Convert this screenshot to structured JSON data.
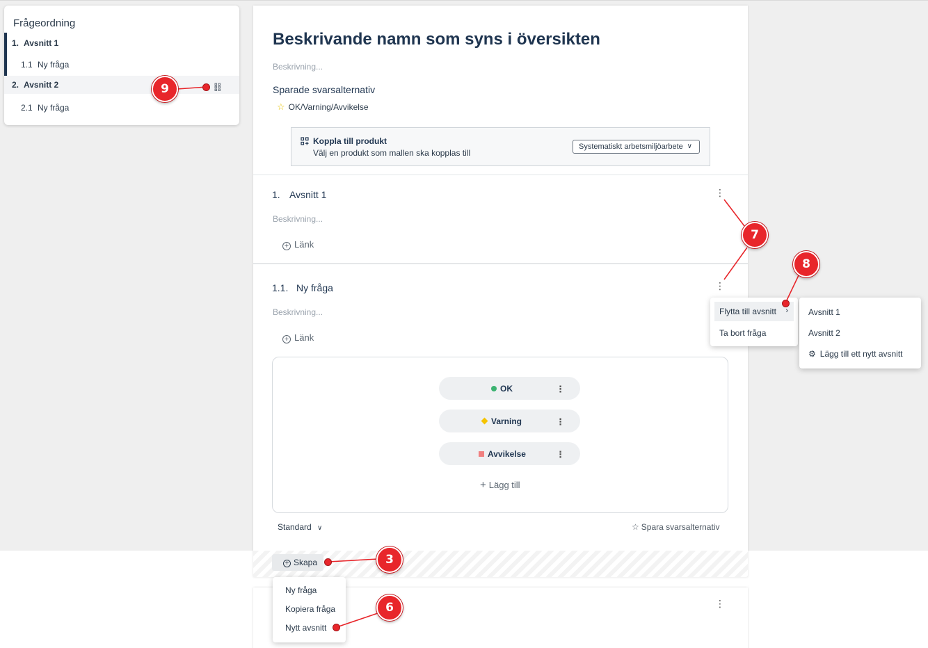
{
  "sidebar": {
    "title": "Frågeordning",
    "items": [
      {
        "num": "1.",
        "label": "Avsnitt 1"
      },
      {
        "num": "1.1",
        "label": "Ny fråga"
      },
      {
        "num": "2.",
        "label": "Avsnitt 2"
      },
      {
        "num": "2.1",
        "label": "Ny fråga"
      }
    ]
  },
  "header": {
    "title": "Beskrivande namn som syns i översikten",
    "description_placeholder": "Beskrivning..."
  },
  "saved_options": {
    "title": "Sparade svarsalternativ",
    "items": [
      "OK/Varning/Avvikelse"
    ]
  },
  "product": {
    "title": "Koppla till produkt",
    "subtitle": "Välj en produkt som mallen ska kopplas till",
    "selected": "Systematiskt arbetsmiljöarbete"
  },
  "section1": {
    "num": "1.",
    "name": "Avsnitt 1",
    "description_placeholder": "Beskrivning...",
    "link_label": "Länk"
  },
  "question1": {
    "num": "1.1.",
    "name": "Ny fråga",
    "description_placeholder": "Beskrivning...",
    "link_label": "Länk",
    "answers": [
      {
        "label": "OK",
        "color": "#3cb371"
      },
      {
        "label": "Varning",
        "color": "#f5c400"
      },
      {
        "label": "Avvikelse",
        "color": "#f08080"
      }
    ],
    "add_label": "Lägg till",
    "type_label": "Standard",
    "save_label": "Spara svarsalternativ"
  },
  "skapa": {
    "label": "Skapa",
    "menu": [
      "Ny fråga",
      "Kopiera fråga",
      "Nytt avsnitt"
    ]
  },
  "question_menu": {
    "items": [
      "Flytta till avsnitt",
      "Ta bort fråga"
    ],
    "submenu": [
      "Avsnitt 1",
      "Avsnitt 2",
      "Lägg till ett nytt avsnitt"
    ]
  },
  "callouts": [
    "9",
    "7",
    "8",
    "3",
    "6"
  ],
  "colors": {
    "accent": "#1f3550",
    "callout": "#e8262b"
  }
}
